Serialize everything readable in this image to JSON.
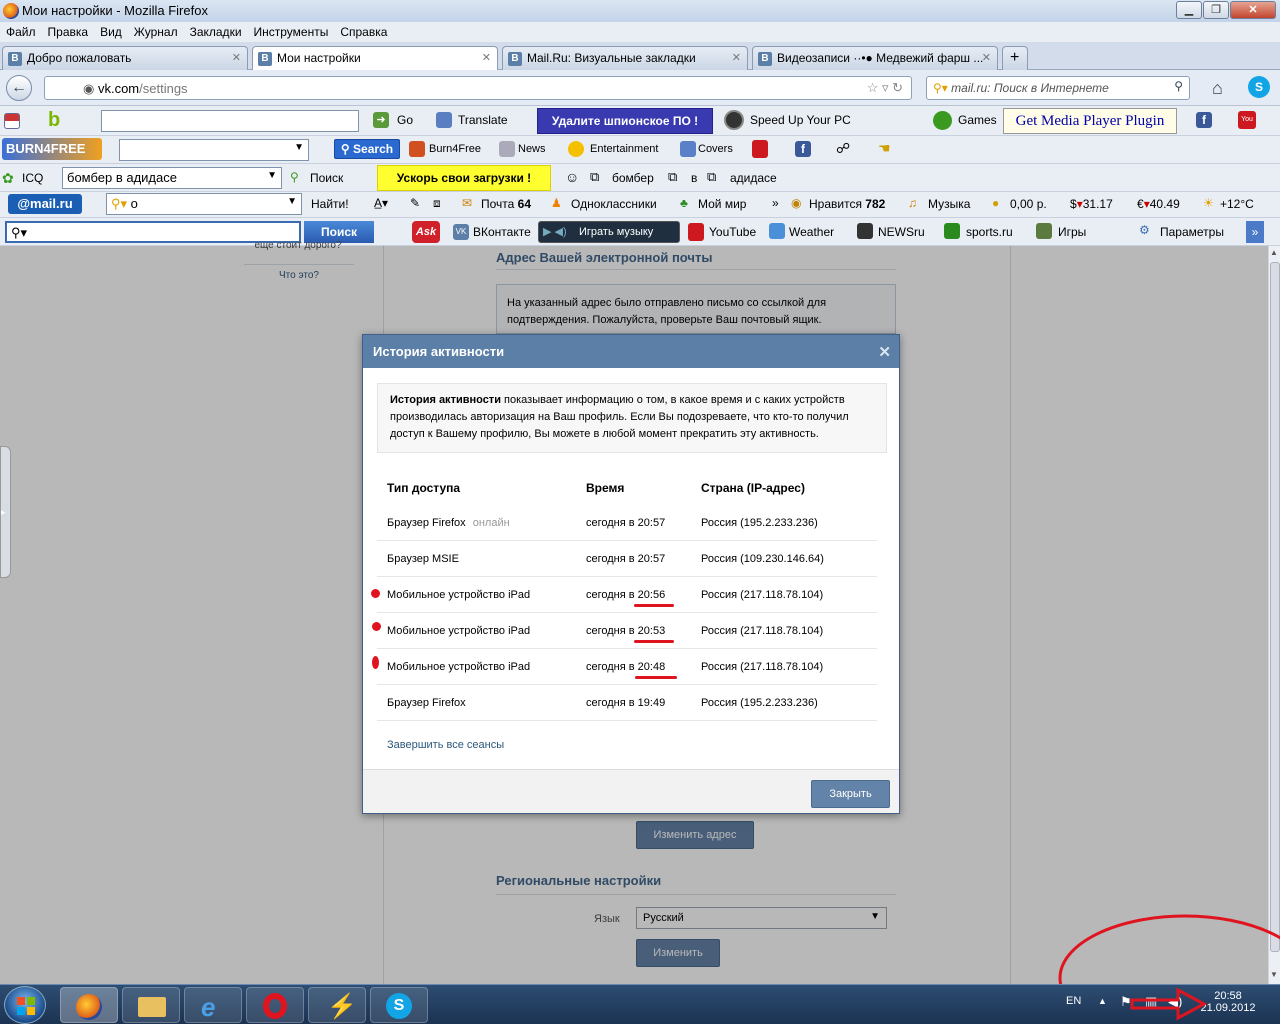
{
  "window": {
    "title": "Мои настройки - Mozilla Firefox"
  },
  "menu": [
    "Файл",
    "Правка",
    "Вид",
    "Журнал",
    "Закладки",
    "Инструменты",
    "Справка"
  ],
  "tabs": [
    {
      "label": "Добро пожаловать",
      "active": false
    },
    {
      "label": "Мои настройки",
      "active": true
    },
    {
      "label": "Mail.Ru: Визуальные закладки",
      "active": false
    },
    {
      "label": "Видеозаписи ··•● Медвежий фарш ...",
      "active": false
    }
  ],
  "nav": {
    "url_domain": "vk.com",
    "url_path": "/settings",
    "search_placeholder": "mail.ru: Поиск в Интернете"
  },
  "toolbar1": {
    "go": "Go",
    "translate": "Translate",
    "spyware": "Удалите шпионское ПО !",
    "speedup": "Speed Up Your PC",
    "games": "Games",
    "plugin": "Get Media Player Plugin"
  },
  "toolbar2": {
    "search": "Search",
    "burn4free": "Burn4Free",
    "news": "News",
    "entertainment": "Entertainment",
    "covers": "Covers"
  },
  "toolbar3": {
    "icq": "ICQ",
    "query": "бомбер в адидасе",
    "search": "Поиск",
    "speed": "Ускорь свои загрузки !",
    "w1": "бомбер",
    "w2": "в",
    "w3": "адидасе"
  },
  "toolbar4": {
    "mailru": "@mail.ru",
    "query": "о",
    "find": "Найти!",
    "mail": "Почта",
    "mail_count": "64",
    "ok": "Одноклассники",
    "moimir": "Мой мир",
    "likes": "Нравится",
    "likes_count": "782",
    "music": "Музыка",
    "money": "0,00 р.",
    "usd": "31.17",
    "eur": "40.49",
    "weather": "+12°C"
  },
  "toolbar5": {
    "search_btn": "Поиск",
    "vk": "ВКонтакте",
    "play_music": "Играть музыку",
    "youtube": "YouTube",
    "weather": "Weather",
    "newsru": "NEWSru",
    "sports": "sports.ru",
    "games": "Игры",
    "params": "Параметры"
  },
  "page": {
    "left_cut": "еще стоит дорого?",
    "whatis": "Что это?",
    "email_heading": "Адрес Вашей электронной почты",
    "email_notice": "На указанный адрес было отправлено письмо со ссылкой для подтверждения. Пожалуйста, проверьте Ваш почтовый ящик.",
    "change_address": "Изменить адрес",
    "regional_heading": "Региональные настройки",
    "lang_label": "Язык",
    "lang_value": "Русский",
    "change": "Изменить"
  },
  "modal": {
    "title": "История активности",
    "info_bold": "История активности",
    "info_rest": " показывает информацию о том, в какое время и с каких устройств производилась авторизация на Ваш профиль. Если Вы подозреваете, что кто-то получил доступ к Вашему профилю, Вы можете в любой момент прекратить эту активность.",
    "col_type": "Тип доступа",
    "col_time": "Время",
    "col_country": "Страна (IP-адрес)",
    "rows": [
      {
        "type": "Браузер Firefox",
        "status": "онлайн",
        "time": "сегодня в 20:57",
        "country": "Россия (195.2.233.236)"
      },
      {
        "type": "Браузер MSIE",
        "status": "",
        "time": "сегодня в 20:57",
        "country": "Россия (109.230.146.64)"
      },
      {
        "type": "Мобильное устройство iPad",
        "status": "",
        "time": "сегодня в 20:56",
        "country": "Россия (217.118.78.104)"
      },
      {
        "type": "Мобильное устройство iPad",
        "status": "",
        "time": "сегодня в 20:53",
        "country": "Россия (217.118.78.104)"
      },
      {
        "type": "Мобильное устройство iPad",
        "status": "",
        "time": "сегодня в 20:48",
        "country": "Россия (217.118.78.104)"
      },
      {
        "type": "Браузер Firefox",
        "status": "",
        "time": "сегодня в 19:49",
        "country": "Россия (195.2.233.236)"
      }
    ],
    "end_sessions": "Завершить все сеансы",
    "close": "Закрыть"
  },
  "taskbar": {
    "lang": "EN",
    "time": "20:58",
    "date": "21.09.2012"
  },
  "colors": {
    "vk_blue": "#5b7fa6",
    "annotation_red": "#e0141e"
  }
}
